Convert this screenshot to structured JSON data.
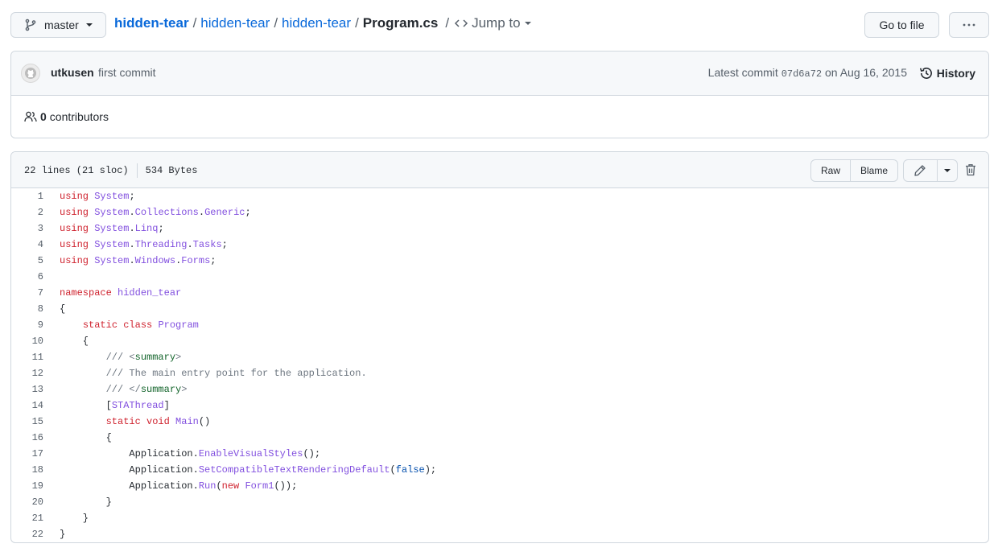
{
  "branch": {
    "name": "master"
  },
  "breadcrumb": {
    "root": "hidden-tear",
    "parts": [
      "hidden-tear",
      "hidden-tear"
    ],
    "file": "Program.cs",
    "jump": "Jump to"
  },
  "actions": {
    "goto_file": "Go to file",
    "more": "···"
  },
  "commit": {
    "author": "utkusen",
    "message": "first commit",
    "latest_label": "Latest commit",
    "sha": "07d6a72",
    "date": "on Aug 16, 2015",
    "history": "History"
  },
  "contributors": {
    "count": "0",
    "label": "contributors"
  },
  "file": {
    "lines_info": "22 lines (21 sloc)",
    "size": "534 Bytes",
    "raw": "Raw",
    "blame": "Blame"
  },
  "code_lines": [
    "using System;",
    "using System.Collections.Generic;",
    "using System.Linq;",
    "using System.Threading.Tasks;",
    "using System.Windows.Forms;",
    "",
    "namespace hidden_tear",
    "{",
    "    static class Program",
    "    {",
    "        /// <summary>",
    "        /// The main entry point for the application.",
    "        /// </summary>",
    "        [STAThread]",
    "        static void Main()",
    "        {",
    "            Application.EnableVisualStyles();",
    "            Application.SetCompatibleTextRenderingDefault(false);",
    "            Application.Run(new Form1());",
    "        }",
    "    }",
    "}"
  ],
  "colors": {
    "link": "#0969da",
    "keyword": "#cf222e",
    "type": "#8250df",
    "comment": "#6e7781",
    "tag": "#116329",
    "constant": "#0550ae"
  }
}
